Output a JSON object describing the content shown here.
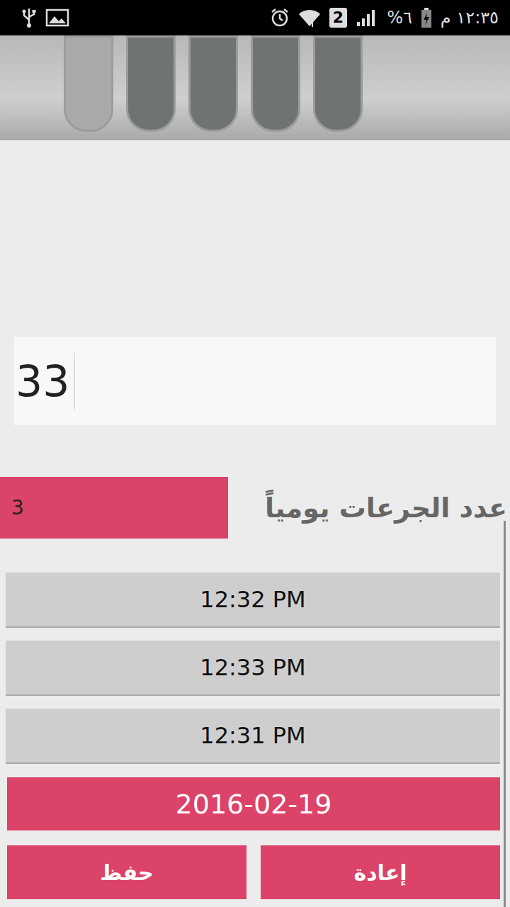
{
  "status_bar": {
    "time": "١٢:٣٥ م",
    "battery": "٦%",
    "sim": "2"
  },
  "dose_field": {
    "value": "33"
  },
  "doses_per_day": {
    "label": "عدد الجرعات يومياً",
    "value": "3"
  },
  "times": [
    "12:32 PM",
    "12:33 PM",
    "12:31 PM"
  ],
  "date": "2016-02-19",
  "buttons": [
    {
      "label": "إعادة"
    },
    {
      "label": "حفظ"
    }
  ]
}
